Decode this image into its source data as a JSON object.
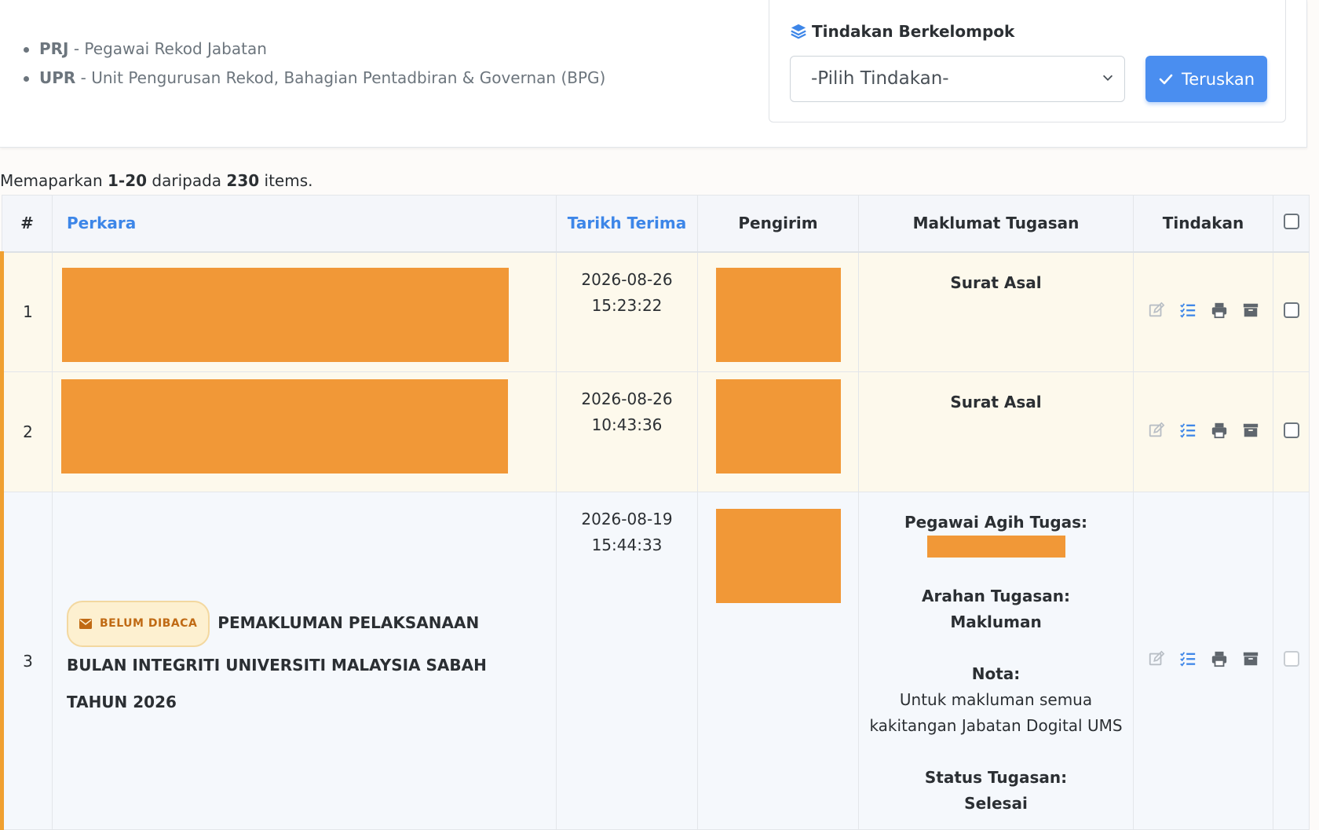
{
  "legend": [
    {
      "abbr": "PRJ",
      "desc": " - Pegawai Rekod Jabatan"
    },
    {
      "abbr": "UPR",
      "desc": " - Unit Pengurusan Rekod, Bahagian Pentadbiran & Governan (BPG)"
    }
  ],
  "bulk": {
    "title": "Tindakan Berkelompok",
    "select_value": "-Pilih Tindakan-",
    "button_label": "Teruskan"
  },
  "summary": {
    "prefix": "Memaparkan ",
    "range": "1-20",
    "middle": " daripada ",
    "total": "230",
    "suffix": " items."
  },
  "table": {
    "headers": {
      "num": "#",
      "perkara": "Perkara",
      "tarikh": "Tarikh Terima",
      "pengirim": "Pengirim",
      "maklumat": "Maklumat Tugasan",
      "tindakan": "Tindakan"
    },
    "rows": [
      {
        "num": "1",
        "date": "2026-08-26",
        "time": "15:23:22",
        "info_title": "Surat Asal"
      },
      {
        "num": "2",
        "date": "2026-08-26",
        "time": "10:43:36",
        "info_title": "Surat Asal"
      },
      {
        "num": "3",
        "date": "2026-08-19",
        "time": "15:44:33",
        "badge": "BELUM DIBACA",
        "subject": "PEMAKLUMAN PELAKSANAAN BULAN INTEGRITI UNIVERSITI MALAYSIA SABAH TAHUN 2026",
        "pegawai_label": "Pegawai Agih Tugas:",
        "arahan_label": "Arahan Tugasan:",
        "arahan_value": "Makluman",
        "nota_label": "Nota:",
        "nota_line1": "Untuk makluman semua",
        "nota_line2": "kakitangan Jabatan Dogital UMS",
        "status_label": "Status Tugasan:",
        "status_value": "Selesai"
      }
    ]
  },
  "colors": {
    "accent": "#4a8ef0",
    "redaction": "#f19837",
    "row_highlight": "#f0a030"
  },
  "icons": [
    "layers-icon",
    "chevron-down-icon",
    "check-icon",
    "edit-icon",
    "checklist-icon",
    "print-icon",
    "archive-icon",
    "envelope-icon"
  ]
}
